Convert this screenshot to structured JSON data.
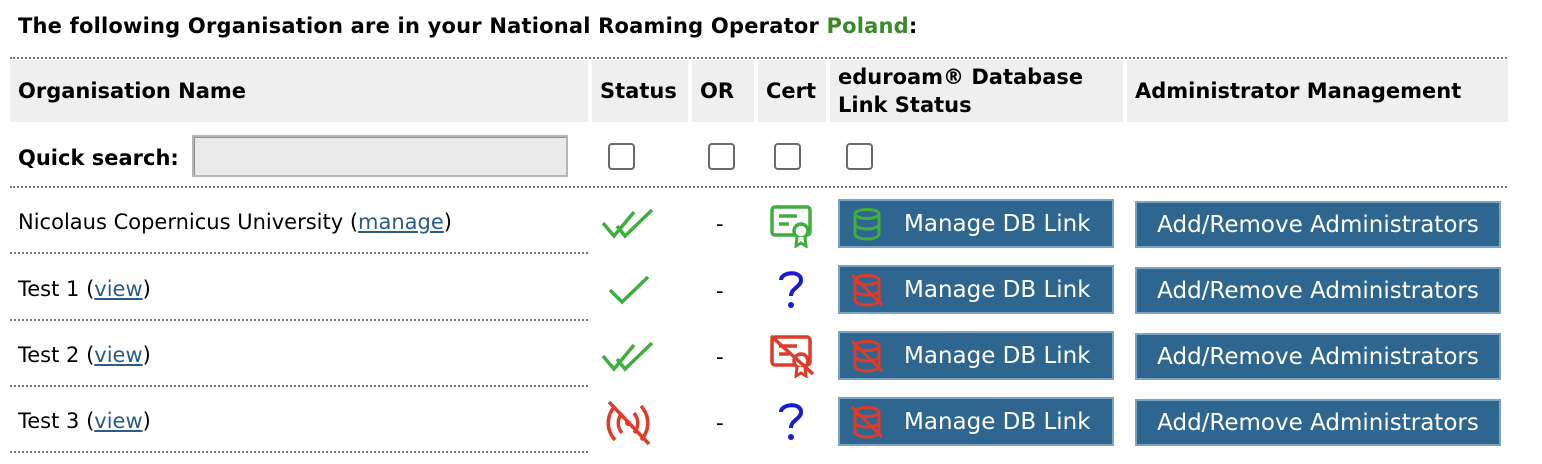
{
  "heading": {
    "prefix": "The following Organisation are in your National Roaming Operator",
    "country": "Poland",
    "suffix": ":"
  },
  "table": {
    "headers": {
      "name": "Organisation Name",
      "status": "Status",
      "or": "OR",
      "cert": "Cert",
      "db_line1": "eduroam® Database",
      "db_line2": "Link Status",
      "admin": "Administrator Management"
    },
    "quick_search_label": "Quick search:",
    "rows": [
      {
        "name": "Nicolaus Copernicus University",
        "open": " (",
        "link": "manage",
        "close": ")",
        "status_icon": "double-check",
        "or": "-",
        "cert_icon": "cert-valid",
        "db_icon": "db-linked",
        "db_button": "Manage DB Link",
        "admin_button": "Add/Remove Administrators"
      },
      {
        "name": "Test 1",
        "open": " (",
        "link": "view",
        "close": ")",
        "status_icon": "check",
        "or": "-",
        "cert_icon": "question",
        "db_icon": "db-unlinked",
        "db_button": "Manage DB Link",
        "admin_button": "Add/Remove Administrators"
      },
      {
        "name": "Test 2",
        "open": " (",
        "link": "view",
        "close": ")",
        "status_icon": "double-check",
        "or": "-",
        "cert_icon": "cert-invalid",
        "db_icon": "db-unlinked",
        "db_button": "Manage DB Link",
        "admin_button": "Add/Remove Administrators"
      },
      {
        "name": "Test 3",
        "open": " (",
        "link": "view",
        "close": ")",
        "status_icon": "signal-off",
        "or": "-",
        "cert_icon": "question",
        "db_icon": "db-unlinked",
        "db_button": "Manage DB Link",
        "admin_button": "Add/Remove Administrators"
      }
    ]
  },
  "colors": {
    "green": "#3fae3f",
    "red": "#e03a2a",
    "blue": "#1a1ad6",
    "button": "#2e6690"
  }
}
